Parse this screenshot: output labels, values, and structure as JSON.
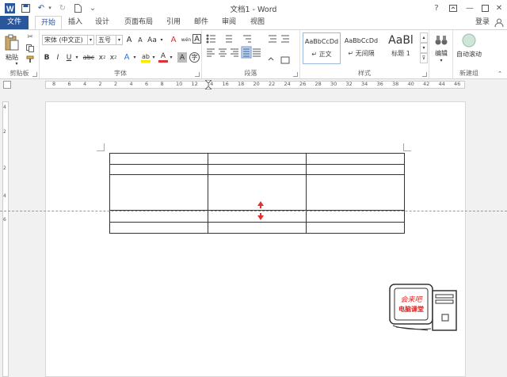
{
  "app": {
    "title": "文档1 - Word"
  },
  "window_controls": {
    "help": "?"
  },
  "tabs": [
    "文件",
    "开始",
    "插入",
    "设计",
    "页面布局",
    "引用",
    "邮件",
    "审阅",
    "视图"
  ],
  "account": {
    "login": "登录"
  },
  "ribbon": {
    "clipboard": {
      "paste_label": "粘贴",
      "group_label": "剪贴板"
    },
    "font": {
      "font_name": "宋体 (中文正)",
      "font_size": "五号",
      "grow": "A",
      "shrink": "A",
      "case": "Aa",
      "clear_format": "A",
      "phonetic": "wén",
      "bold": "B",
      "italic": "I",
      "underline": "U",
      "strike": "abc",
      "subscript": "x",
      "superscript": "x",
      "text_effect": "A",
      "highlight": "ab",
      "font_color": "A",
      "char_shading": "A",
      "enclose": "字",
      "group_label": "字体"
    },
    "paragraph": {
      "group_label": "段落"
    },
    "styles": {
      "items": [
        {
          "preview": "AaBbCcDd",
          "name": "↵ 正文"
        },
        {
          "preview": "AaBbCcDd",
          "name": "↵ 无间隔"
        },
        {
          "preview": "AaBl",
          "name": "标题 1"
        }
      ],
      "group_label": "样式"
    },
    "editing": {
      "label": "编辑"
    },
    "new_group": {
      "label": "自动滚动",
      "group_label": "新建组"
    }
  },
  "ruler": {
    "h_numbers": [
      "8",
      "6",
      "4",
      "2",
      "2",
      "4",
      "6",
      "8",
      "10",
      "12",
      "14",
      "16",
      "18",
      "20",
      "22",
      "24",
      "26",
      "28",
      "30",
      "32",
      "34",
      "36",
      "38",
      "40",
      "42",
      "44",
      "46"
    ],
    "v_numbers": [
      "4",
      "2",
      "2",
      "4",
      "6"
    ]
  },
  "watermark": {
    "line1": "会来吧",
    "line2": "电脑课堂"
  },
  "colors": {
    "accent": "#2b579a",
    "arrow": "#e03030",
    "watermark": "#e02020"
  }
}
